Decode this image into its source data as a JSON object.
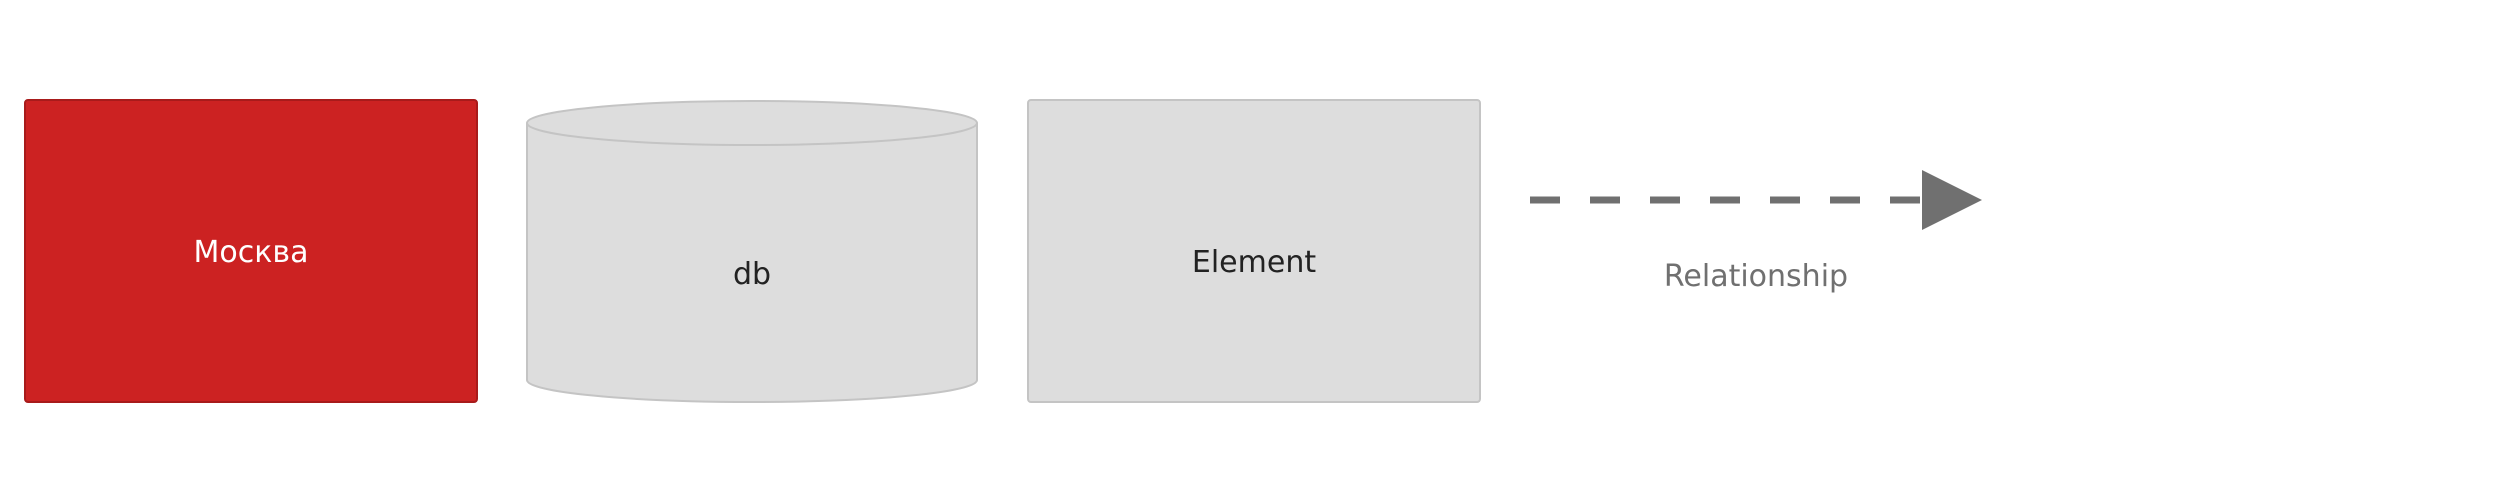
{
  "legend": {
    "moscow": {
      "label": "Москва",
      "fill": "#cc2222",
      "stroke": "#a81b1b",
      "text_color": "#ffffff"
    },
    "db": {
      "label": "db",
      "fill": "#dddddd",
      "stroke": "#c4c4c4",
      "text_color": "#222222"
    },
    "element": {
      "label": "Element",
      "fill": "#dddddd",
      "stroke": "#c4c4c4",
      "text_color": "#222222"
    },
    "relationship": {
      "label": "Relationship",
      "line_color": "#707070",
      "text_color": "#707070",
      "style": "dashed"
    }
  }
}
